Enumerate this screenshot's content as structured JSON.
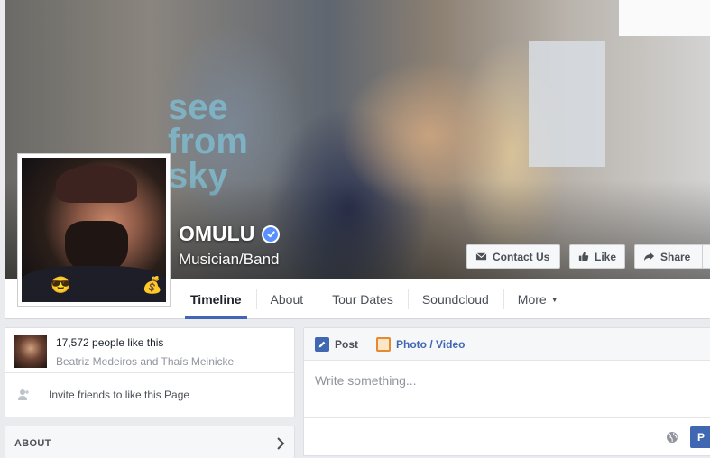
{
  "page": {
    "name": "OMULU",
    "category": "Musician/Band",
    "cover_shirt_text": [
      "see",
      "from",
      "sky"
    ]
  },
  "cover_buttons": {
    "contact": "Contact Us",
    "like": "Like",
    "share": "Share"
  },
  "tabs": [
    {
      "label": "Timeline",
      "active": true
    },
    {
      "label": "About",
      "active": false
    },
    {
      "label": "Tour Dates",
      "active": false
    },
    {
      "label": "Soundcloud",
      "active": false
    },
    {
      "label": "More",
      "active": false
    }
  ],
  "likes": {
    "count_text": "17,572 people like this",
    "friends_text": "Beatriz Medeiros and Thaís Meinicke",
    "invite_text": "Invite friends to like this Page"
  },
  "about": {
    "label": "ABOUT"
  },
  "composer": {
    "tab_post": "Post",
    "tab_photo": "Photo / Video",
    "placeholder": "Write something...",
    "post_button": "P"
  },
  "colors": {
    "accent": "#4267b2",
    "verified": "#5890ff",
    "background": "#e9ebee"
  },
  "icons": [
    "verified-badge-icon",
    "envelope-icon",
    "thumbs-up-icon",
    "share-arrow-icon",
    "pencil-icon",
    "photo-icon",
    "person-add-icon",
    "chevron-right-icon",
    "globe-icon",
    "caret-down-icon"
  ]
}
